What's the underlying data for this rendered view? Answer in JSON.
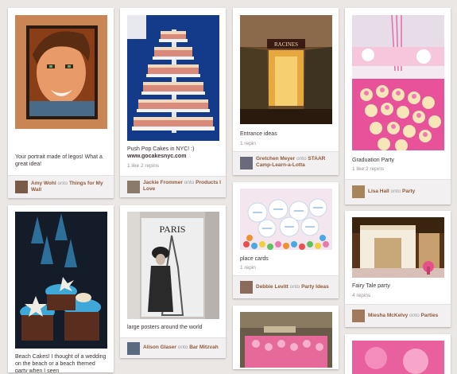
{
  "pins": [
    {
      "description": "Your portrait made of legos! What a great idea!",
      "stats": "",
      "user": "Amy Wohl",
      "onto": "onto",
      "board": "Things for My Wall"
    },
    {
      "description": "Push Pop Cakes in NYC! :)",
      "url": "www.gocakesnyc.com",
      "stats": "1 like  2 repins",
      "user": "Jackie Frommer",
      "onto": "onto",
      "board": "Products I Love"
    },
    {
      "description": "Entrance ideas",
      "stats": "1 repin",
      "user": "Gretchen Meyer",
      "onto": "onto",
      "board": "STAAR Camp-Learn-a-Lotta"
    },
    {
      "description": "Graduation Party",
      "stats": "1 like  2 repins",
      "user": "Lisa Hall",
      "onto": "onto",
      "board": "Party"
    },
    {
      "description": "Beach Cakes! I thought of a wedding on the beach or a beach themed party when I seen",
      "stats": "",
      "user": "",
      "onto": "",
      "board": ""
    },
    {
      "description": "large posters around the world",
      "stats": "",
      "user": "Alison Glaser",
      "onto": "onto",
      "board": "Bar Mitzvah"
    },
    {
      "description": "place cards",
      "stats": "1 repin",
      "user": "Debbie Levitt",
      "onto": "onto",
      "board": "Party Ideas"
    },
    {
      "description": "Fairy Tale party",
      "stats": "4 repins",
      "user": "Miesha McKelvy",
      "onto": "onto",
      "board": "Parties"
    },
    {
      "description": "",
      "stats": "",
      "user": "",
      "onto": "",
      "board": ""
    },
    {
      "description": "",
      "stats": "",
      "user": "",
      "onto": "",
      "board": ""
    }
  ],
  "signs": {
    "racines": "RACINES",
    "paris": "PARIS"
  },
  "colors": {
    "background": "#ebe7e5",
    "link": "#8c5a3c",
    "pink": "#e8529a"
  },
  "icons": [
    "avatar",
    "avatar",
    "avatar",
    "avatar",
    "avatar",
    "avatar",
    "avatar"
  ]
}
